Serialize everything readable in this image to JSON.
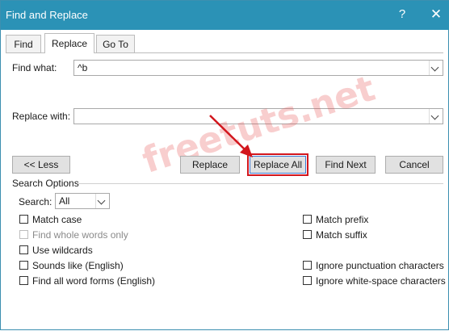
{
  "window": {
    "title": "Find and Replace",
    "help": "?",
    "close": "✕"
  },
  "tabs": [
    {
      "label": "Find",
      "active": false
    },
    {
      "label": "Replace",
      "active": true
    },
    {
      "label": "Go To",
      "active": false
    }
  ],
  "find": {
    "label": "Find what:",
    "value": "^b"
  },
  "replace": {
    "label": "Replace with:",
    "value": ""
  },
  "buttons": {
    "less": "<< Less",
    "replace": "Replace",
    "replace_all": "Replace All",
    "find_next": "Find Next",
    "cancel": "Cancel"
  },
  "search_options": {
    "heading": "Search Options",
    "search_label": "Search:",
    "search_value": "All",
    "left": [
      {
        "label": "Match case",
        "checked": false,
        "enabled": true
      },
      {
        "label": "Find whole words only",
        "checked": false,
        "enabled": false
      },
      {
        "label": "Use wildcards",
        "checked": false,
        "enabled": true
      },
      {
        "label": "Sounds like (English)",
        "checked": false,
        "enabled": true
      },
      {
        "label": "Find all word forms (English)",
        "checked": false,
        "enabled": true
      }
    ],
    "right": [
      {
        "label": "Match prefix",
        "checked": false,
        "enabled": true
      },
      {
        "label": "Match suffix",
        "checked": false,
        "enabled": true
      },
      {
        "label": "Ignore punctuation characters",
        "checked": false,
        "enabled": true
      },
      {
        "label": "Ignore white-space characters",
        "checked": false,
        "enabled": true
      }
    ]
  },
  "watermark": "freetuts.net",
  "colors": {
    "titlebar": "#2b92b6",
    "highlight": "#d2161d"
  }
}
